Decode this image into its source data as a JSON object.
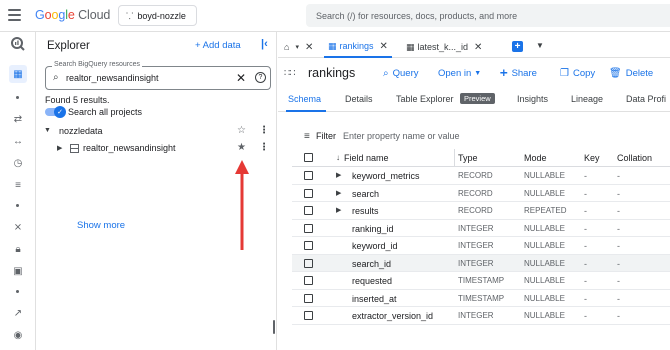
{
  "header": {
    "logo": [
      "G",
      "o",
      "o",
      "g",
      "l",
      "e",
      " Cloud"
    ],
    "project": "boyd-nozzle",
    "search_placeholder": "Search (/) for resources, docs, products, and more"
  },
  "explorer": {
    "title": "Explorer",
    "add_data": "+ Add data",
    "search_label": "Search BigQuery resources",
    "search_value": "realtor_newsandinsight",
    "found": "Found 5 results.",
    "toggle_label": "Search all projects",
    "project": "nozzledata",
    "dataset": "realtor_newsandinsight",
    "show_more": "Show more"
  },
  "tabs": {
    "items": [
      {
        "label": "rankings"
      },
      {
        "label": "latest_k..._id"
      }
    ]
  },
  "table": {
    "title": "rankings",
    "actions": {
      "query": "Query",
      "open_in": "Open in",
      "share": "Share",
      "copy": "Copy",
      "delete": "Delete"
    }
  },
  "subtabs": {
    "schema": "Schema",
    "details": "Details",
    "explorer": "Table Explorer",
    "preview_badge": "Preview",
    "insights": "Insights",
    "lineage": "Lineage",
    "profile": "Data Profi"
  },
  "filter": {
    "label": "Filter",
    "placeholder": "Enter property name or value"
  },
  "schema": {
    "headers": {
      "field": "Field name",
      "type": "Type",
      "mode": "Mode",
      "key": "Key",
      "collation": "Collation"
    },
    "rows": [
      {
        "name": "keyword_metrics",
        "type": "RECORD",
        "mode": "NULLABLE",
        "key": "-",
        "collation": "-",
        "expand": true
      },
      {
        "name": "search",
        "type": "RECORD",
        "mode": "NULLABLE",
        "key": "-",
        "collation": "-",
        "expand": true
      },
      {
        "name": "results",
        "type": "RECORD",
        "mode": "REPEATED",
        "key": "-",
        "collation": "-",
        "expand": true
      },
      {
        "name": "ranking_id",
        "type": "INTEGER",
        "mode": "NULLABLE",
        "key": "-",
        "collation": "-"
      },
      {
        "name": "keyword_id",
        "type": "INTEGER",
        "mode": "NULLABLE",
        "key": "-",
        "collation": "-"
      },
      {
        "name": "search_id",
        "type": "INTEGER",
        "mode": "NULLABLE",
        "key": "-",
        "collation": "-"
      },
      {
        "name": "requested",
        "type": "TIMESTAMP",
        "mode": "NULLABLE",
        "key": "-",
        "collation": "-"
      },
      {
        "name": "inserted_at",
        "type": "TIMESTAMP",
        "mode": "NULLABLE",
        "key": "-",
        "collation": "-"
      },
      {
        "name": "extractor_version_id",
        "type": "INTEGER",
        "mode": "NULLABLE",
        "key": "-",
        "collation": "-"
      }
    ]
  },
  "colors": {
    "accent": "#1a73e8",
    "annotation_arrow": "#e53935"
  }
}
